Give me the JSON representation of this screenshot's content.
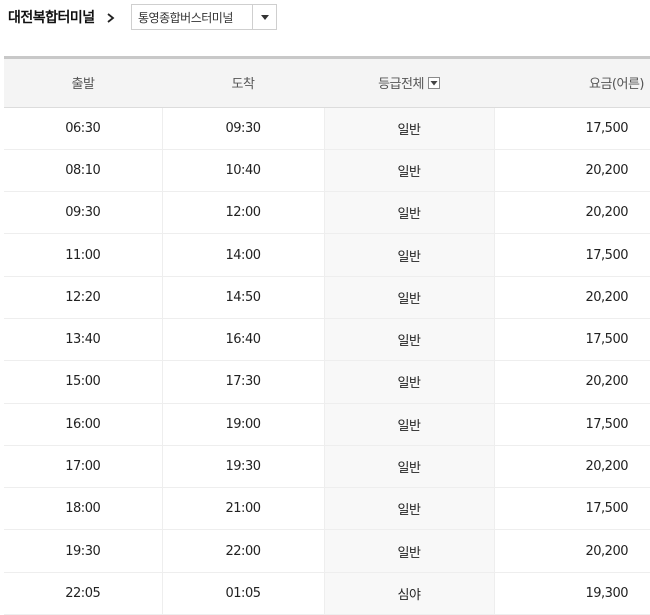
{
  "route": {
    "origin": "대전복합터미널",
    "destination": "통영종합버스터미널"
  },
  "table": {
    "headers": {
      "departure": "출발",
      "arrival": "도착",
      "grade": "등급전체",
      "fare": "요금(어른)"
    },
    "rows": [
      {
        "departure": "06:30",
        "arrival": "09:30",
        "grade": "일반",
        "fare": "17,500"
      },
      {
        "departure": "08:10",
        "arrival": "10:40",
        "grade": "일반",
        "fare": "20,200"
      },
      {
        "departure": "09:30",
        "arrival": "12:00",
        "grade": "일반",
        "fare": "20,200"
      },
      {
        "departure": "11:00",
        "arrival": "14:00",
        "grade": "일반",
        "fare": "17,500"
      },
      {
        "departure": "12:20",
        "arrival": "14:50",
        "grade": "일반",
        "fare": "20,200"
      },
      {
        "departure": "13:40",
        "arrival": "16:40",
        "grade": "일반",
        "fare": "17,500"
      },
      {
        "departure": "15:00",
        "arrival": "17:30",
        "grade": "일반",
        "fare": "20,200"
      },
      {
        "departure": "16:00",
        "arrival": "19:00",
        "grade": "일반",
        "fare": "17,500"
      },
      {
        "departure": "17:00",
        "arrival": "19:30",
        "grade": "일반",
        "fare": "20,200"
      },
      {
        "departure": "18:00",
        "arrival": "21:00",
        "grade": "일반",
        "fare": "17,500"
      },
      {
        "departure": "19:30",
        "arrival": "22:00",
        "grade": "일반",
        "fare": "20,200"
      },
      {
        "departure": "22:05",
        "arrival": "01:05",
        "grade": "심야",
        "fare": "19,300"
      }
    ]
  },
  "icons": {
    "separator": "chevron-right-icon",
    "dropdown": "caret-down-icon",
    "grade_filter": "caret-down-icon"
  },
  "colors": {
    "header_bg": "#f4f4f4",
    "grade_col_bg": "#f8f8f8",
    "top_border": "#c8c8c8"
  }
}
